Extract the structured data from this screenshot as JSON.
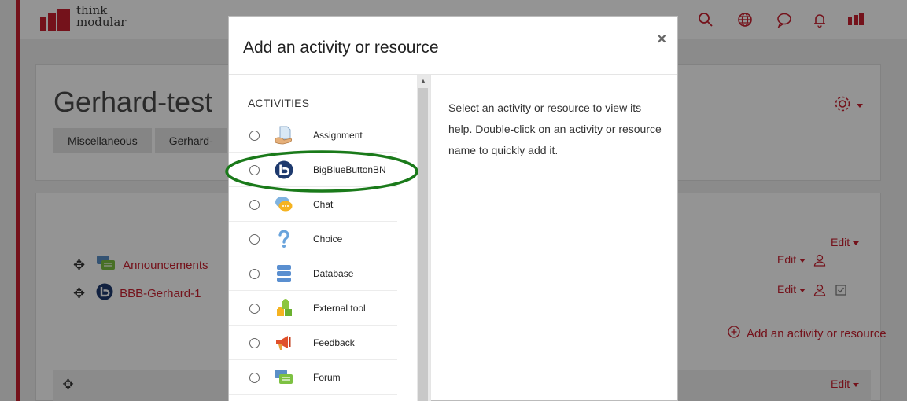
{
  "navbar": {
    "logo_line1": "think",
    "logo_line2": "modular",
    "icons": [
      "search-icon",
      "language-icon",
      "messages-icon",
      "notifications-icon",
      "user-avatar-icon"
    ]
  },
  "course": {
    "title": "Gerhard-test",
    "breadcrumb": [
      "Miscellaneous",
      "Gerhard-"
    ]
  },
  "activities_list": [
    {
      "label": "Announcements",
      "icon": "forum-icon"
    },
    {
      "label": "BBB-Gerhard-1",
      "icon": "bigbluebutton-icon"
    }
  ],
  "edit_label": "Edit",
  "add_activity_label": "Add an activity or resource",
  "modal": {
    "title": "Add an activity or resource",
    "close_label": "×",
    "section_heading": "ACTIVITIES",
    "help_text": "Select an activity or resource to view its help. Double-click on an activity or resource name to quickly add it.",
    "options": [
      {
        "label": "Assignment",
        "icon": "assignment-icon"
      },
      {
        "label": "BigBlueButtonBN",
        "icon": "bigbluebutton-icon"
      },
      {
        "label": "Chat",
        "icon": "chat-icon"
      },
      {
        "label": "Choice",
        "icon": "choice-icon"
      },
      {
        "label": "Database",
        "icon": "database-icon"
      },
      {
        "label": "External tool",
        "icon": "external-tool-icon"
      },
      {
        "label": "Feedback",
        "icon": "feedback-icon"
      },
      {
        "label": "Forum",
        "icon": "forum-icon"
      }
    ],
    "highlighted_option": "BigBlueButtonBN"
  },
  "colors": {
    "brand_red": "#c9202f",
    "highlight_green": "#1a7a1a",
    "bbb_blue": "#1e3a6e"
  }
}
